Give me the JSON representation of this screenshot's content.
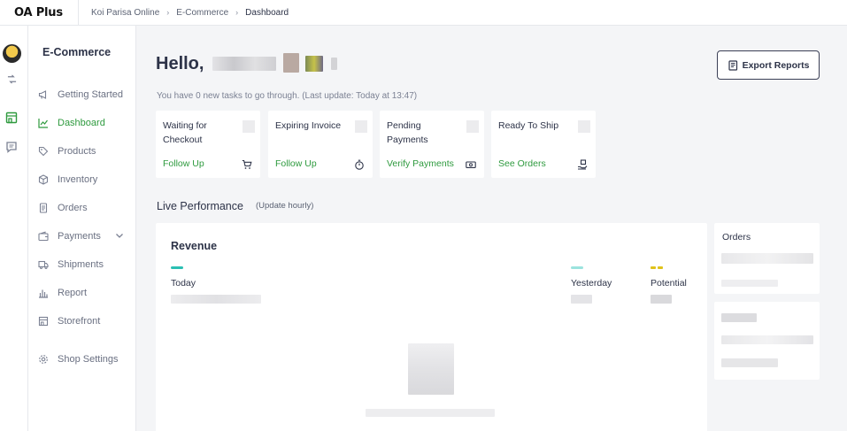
{
  "app": {
    "logo": "OA Plus"
  },
  "breadcrumb": [
    "Koi Parisa Online",
    "E-Commerce",
    "Dashboard"
  ],
  "sidebar": {
    "title": "E-Commerce",
    "items": [
      {
        "label": "Getting Started",
        "icon": "megaphone-icon"
      },
      {
        "label": "Dashboard",
        "icon": "chart-line-icon",
        "active": true
      },
      {
        "label": "Products",
        "icon": "tag-icon"
      },
      {
        "label": "Inventory",
        "icon": "box-icon"
      },
      {
        "label": "Orders",
        "icon": "document-icon"
      },
      {
        "label": "Payments",
        "icon": "wallet-icon",
        "has_submenu": true
      },
      {
        "label": "Shipments",
        "icon": "truck-icon"
      },
      {
        "label": "Report",
        "icon": "bar-chart-icon"
      },
      {
        "label": "Storefront",
        "icon": "store-icon"
      },
      {
        "label": "Shop Settings",
        "icon": "gear-icon"
      }
    ]
  },
  "main": {
    "greeting": "Hello,",
    "export_label": "Export Reports",
    "tasks_summary": "You have 0 new tasks to go through. (Last update: Today at 13:47)",
    "task_cards": [
      {
        "title": "Waiting for Checkout",
        "action": "Follow Up",
        "icon": "cart-icon"
      },
      {
        "title": "Expiring Invoice",
        "action": "Follow Up",
        "icon": "stopwatch-icon"
      },
      {
        "title": "Pending Payments",
        "action": "Verify Payments",
        "icon": "cash-icon"
      },
      {
        "title": "Ready To Ship",
        "action": "See Orders",
        "icon": "package-hand-icon"
      }
    ],
    "live_title": "Live Performance",
    "live_sub": "(Update hourly)",
    "revenue": {
      "title": "Revenue",
      "legend": [
        {
          "label": "Today",
          "color": "#2bbfb3",
          "style": "solid"
        },
        {
          "label": "Yesterday",
          "color": "#9be3de",
          "style": "solid"
        },
        {
          "label": "Potential",
          "color": "#e0c21a",
          "style": "dashed"
        }
      ]
    },
    "orders_title": "Orders"
  },
  "colors": {
    "accent_green": "#2e9a3e",
    "text_dark": "#2d3348",
    "border": "#e6e8ec"
  }
}
